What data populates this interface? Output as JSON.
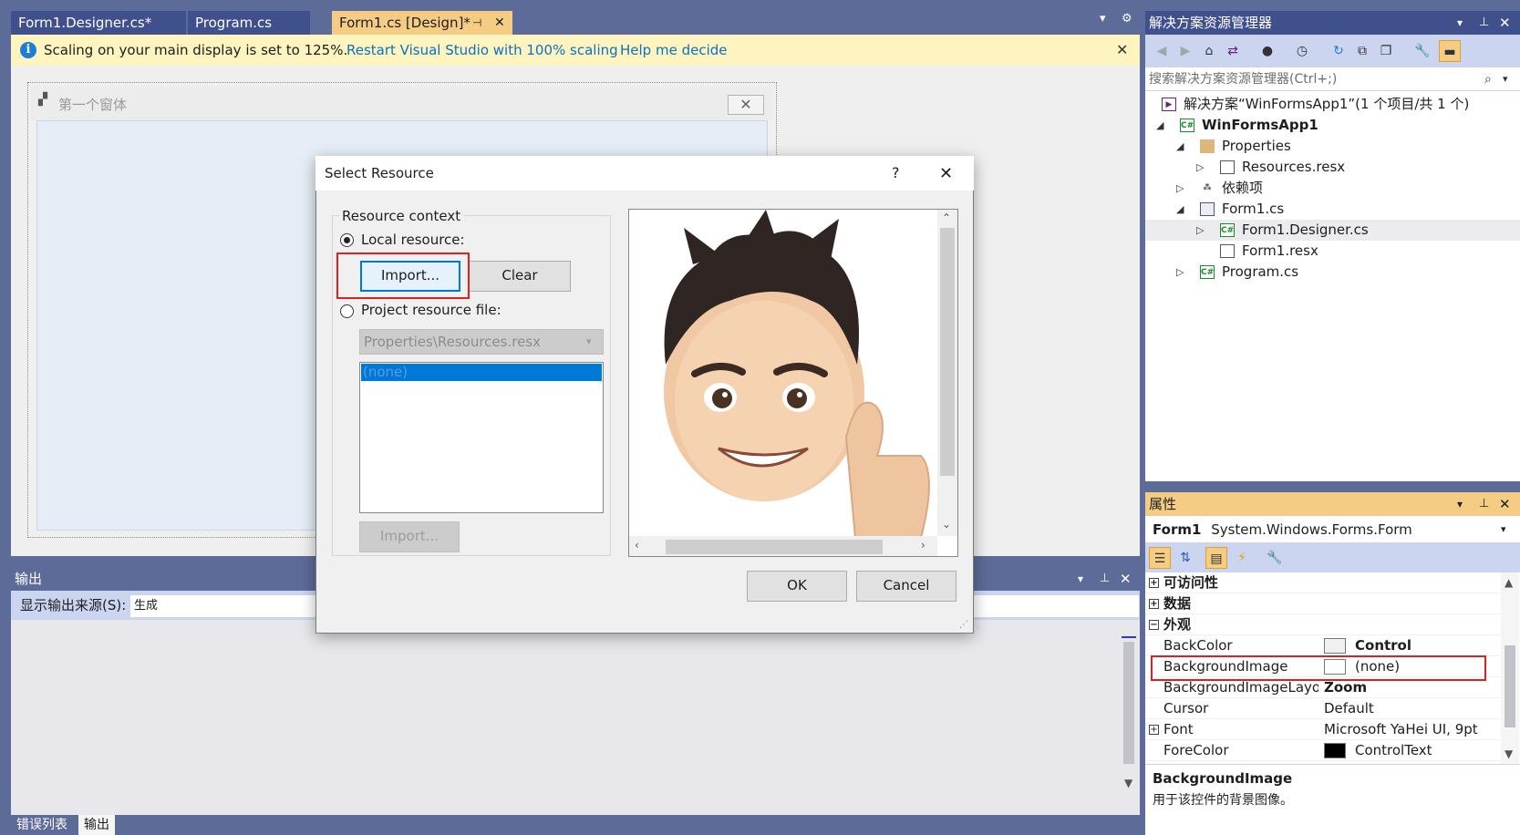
{
  "tabs": [
    {
      "label": "Form1.Designer.cs*"
    },
    {
      "label": "Program.cs"
    },
    {
      "label": "Form1.cs [Design]*"
    }
  ],
  "infobar": {
    "message": "Scaling on your main display is set to 125%.",
    "restart_link": "Restart Visual Studio with 100% scaling",
    "help_link": "Help me decide"
  },
  "form": {
    "title": "第一个窗体"
  },
  "dialog": {
    "title": "Select Resource",
    "help": "?",
    "group_label": "Resource context",
    "local_resource": "Local resource:",
    "import": "Import...",
    "clear": "Clear",
    "project_resource_file": "Project resource file:",
    "resx_path": "Properties\\Resources.resx",
    "list_selected": "(none)",
    "import_disabled": "Import...",
    "ok": "OK",
    "cancel": "Cancel",
    "preview_icon": "memoji-thumbs-up"
  },
  "output": {
    "title": "输出",
    "source_label": "显示输出来源(S):",
    "source_value": "生成"
  },
  "bottom_tabs": [
    "错误列表",
    "输出"
  ],
  "solution_explorer": {
    "title": "解决方案资源管理器",
    "search_placeholder": "搜索解决方案资源管理器(Ctrl+;)",
    "tree": [
      {
        "label": "解决方案“WinFormsApp1”(1 个项目/共 1 个)",
        "icon": "solution-icon"
      },
      {
        "label": "WinFormsApp1",
        "icon": "csharp-project-icon"
      },
      {
        "label": "Properties",
        "icon": "folder-icon"
      },
      {
        "label": "Resources.resx",
        "icon": "file-icon"
      },
      {
        "label": "依赖项",
        "icon": "dependencies-icon"
      },
      {
        "label": "Form1.cs",
        "icon": "form-icon"
      },
      {
        "label": "Form1.Designer.cs",
        "icon": "csharp-file-icon"
      },
      {
        "label": "Form1.resx",
        "icon": "file-icon"
      },
      {
        "label": "Program.cs",
        "icon": "csharp-file-icon"
      }
    ]
  },
  "properties": {
    "title": "属性",
    "object_name": "Form1",
    "object_type": "System.Windows.Forms.Form",
    "categories": {
      "accessibility": "可访问性",
      "data": "数据",
      "appearance": "外观"
    },
    "rows": [
      {
        "name": "BackColor",
        "value": "Control"
      },
      {
        "name": "BackgroundImage",
        "value": "(none)"
      },
      {
        "name": "BackgroundImageLayout",
        "value": "Zoom"
      },
      {
        "name": "Cursor",
        "value": "Default"
      },
      {
        "name": "Font",
        "value": "Microsoft YaHei UI, 9pt"
      },
      {
        "name": "ForeColor",
        "value": "ControlText"
      }
    ],
    "desc_title": "BackgroundImage",
    "desc_text": "用于该控件的背景图像。"
  },
  "colors": {
    "accent": "#0078d7",
    "highlight": "#e02020",
    "ide_chrome": "#5d6b99",
    "active_tab": "#f5cc84"
  }
}
